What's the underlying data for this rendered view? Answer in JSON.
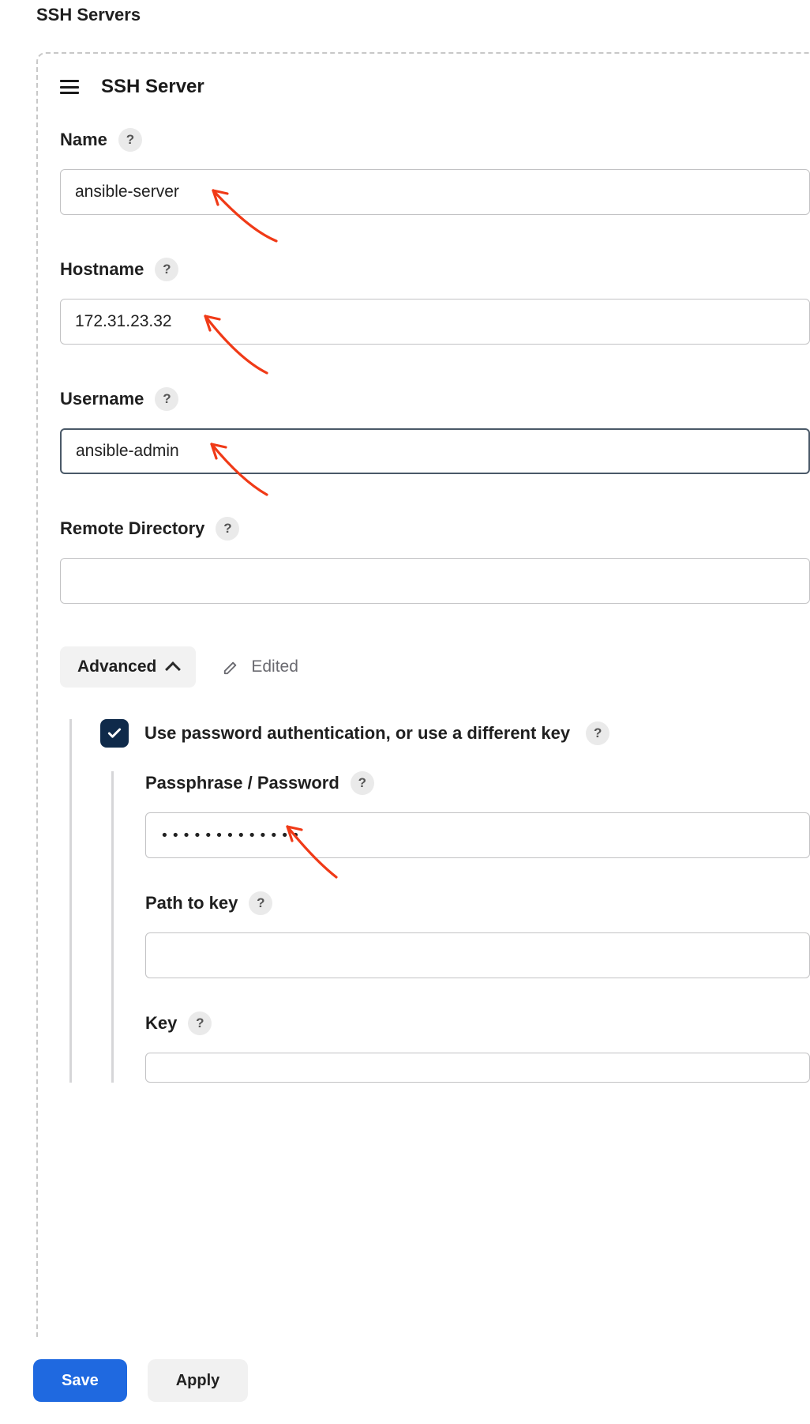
{
  "sectionTitle": "SSH Servers",
  "server": {
    "title": "SSH Server",
    "fields": {
      "name": {
        "label": "Name",
        "value": "ansible-server"
      },
      "hostname": {
        "label": "Hostname",
        "value": "172.31.23.32"
      },
      "username": {
        "label": "Username",
        "value": "ansible-admin"
      },
      "remoteDirectory": {
        "label": "Remote Directory",
        "value": ""
      }
    },
    "advanced": {
      "toggleLabel": "Advanced",
      "editedLabel": "Edited",
      "usePasswordAuth": {
        "checked": true,
        "label": "Use password authentication, or use a different key"
      },
      "passphrase": {
        "label": "Passphrase / Password",
        "value": "•••••••••••••"
      },
      "pathToKey": {
        "label": "Path to key",
        "value": ""
      },
      "key": {
        "label": "Key",
        "value": ""
      }
    }
  },
  "footer": {
    "saveLabel": "Save",
    "applyLabel": "Apply"
  },
  "helpGlyph": "?"
}
